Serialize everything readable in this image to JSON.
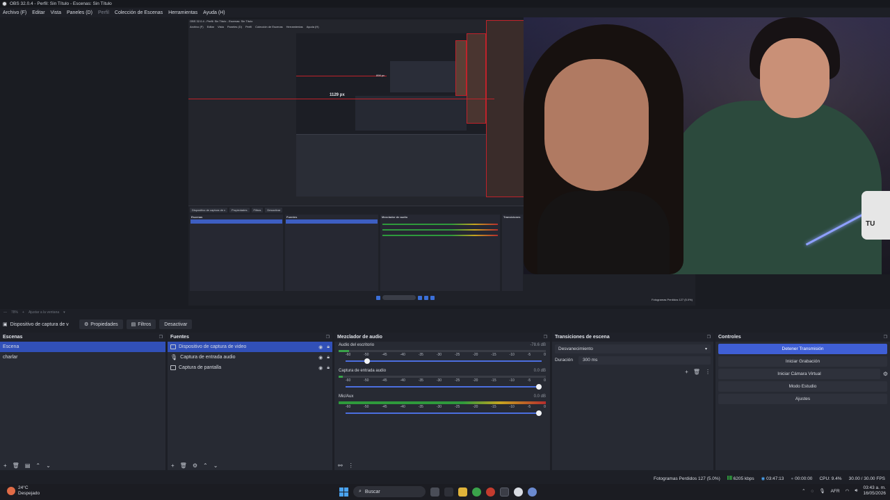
{
  "window": {
    "title": "OBS 32.0.4 - Perfil: Sin Título - Escenas: Sin Título"
  },
  "menu": [
    "Archivo (F)",
    "Editar",
    "Vista",
    "Paneles (D)",
    "Perfil",
    "Colección de Escenas",
    "Herramientas",
    "Ayuda (H)"
  ],
  "preview": {
    "nested_label": "1129 px",
    "nested_label2": "898 px",
    "nested_title": "OBS 32.0.4 - Perfil: Sin Título - Escenas: Sin Título",
    "nested_menu": [
      "Archivo (F)",
      "Editar",
      "Vista",
      "Paneles (D)",
      "Perfil",
      "Colección de Escenas",
      "Herramientas",
      "Ayuda (H)"
    ],
    "nested_tabs": [
      "Dispositivo de captura de v",
      "Propiedades",
      "Filtros",
      "Desactivar"
    ],
    "nested_docks": [
      "Escenas",
      "Fuentes",
      "Mezclador de audio",
      "Transiciones"
    ],
    "nested_status": "Fotogramas Perdidos 127 (5.0%)",
    "mug_text": "TU"
  },
  "zoom": {
    "percent": "78%",
    "fit": "Ajustar a la ventana"
  },
  "context": {
    "source_name": "Dispositivo de captura de v",
    "properties": "Propiedades",
    "filters": "Filtros",
    "deactivate": "Desactivar"
  },
  "scenes": {
    "title": "Escenas",
    "items": [
      {
        "label": "Escena",
        "selected": true
      },
      {
        "label": "charlar",
        "selected": false
      }
    ]
  },
  "sources": {
    "title": "Fuentes",
    "items": [
      {
        "label": "Dispositivo de captura de video",
        "icon": "camera-icon",
        "selected": true
      },
      {
        "label": "Captura de entrada audio",
        "icon": "mic-icon",
        "selected": false
      },
      {
        "label": "Captura de pantalla",
        "icon": "monitor-icon",
        "selected": false
      }
    ]
  },
  "mixer": {
    "title": "Mezclador de audio",
    "scale": [
      "-60",
      "-55",
      "-50",
      "-45",
      "-40",
      "-35",
      "-30",
      "-25",
      "-20",
      "-15",
      "-10",
      "-5",
      "0"
    ],
    "channels": [
      {
        "name": "Audio del escritorio",
        "db": "-78.6 dB",
        "level": 0.05,
        "volume": 0.1
      },
      {
        "name": "Captura de entrada audio",
        "db": "0.0 dB",
        "level": 0.02,
        "volume": 1.0
      },
      {
        "name": "Mic/Aux",
        "db": "0.0 dB",
        "level": 0.98,
        "volume": 1.0
      }
    ]
  },
  "transitions": {
    "title": "Transiciones de escena",
    "selected": "Desvanecimiento",
    "duration_label": "Duración",
    "duration_value": "300 ms"
  },
  "controls": {
    "title": "Controles",
    "buttons": [
      "Detener Transmisión",
      "Iniciar Grabación",
      "Iniciar Cámara Virtual",
      "Modo Estudio",
      "Ajustes"
    ]
  },
  "status": {
    "dropped": "Fotogramas Perdidos 127 (5.0%)",
    "bitrate": "6205 kbps",
    "stream_time": "03:47:13",
    "rec_time": "00:00:00",
    "cpu": "CPU: 9.4%",
    "fps": "30.00 / 30.00 FPS"
  },
  "taskbar": {
    "temp": "24°C",
    "weather": "Despejado",
    "search": "Buscar",
    "lang": "AFR",
    "time": "03:43 a. m.",
    "date": "16/05/2026"
  },
  "colors": {
    "accent": "#3f5fd6",
    "selection": "#3150b8",
    "panel": "#272a33",
    "background": "#1d1f26"
  }
}
